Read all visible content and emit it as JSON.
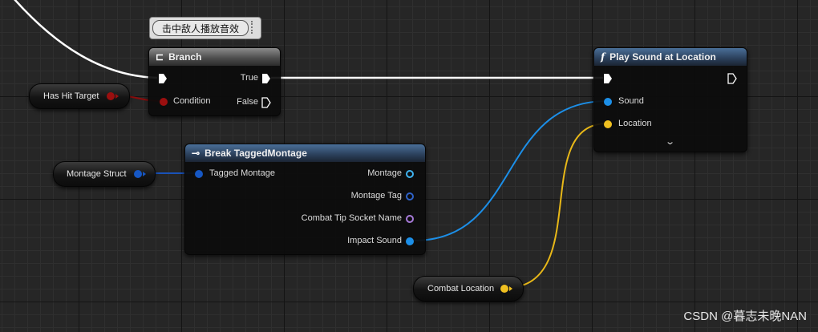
{
  "comment": {
    "text": "击中敌人播放音效"
  },
  "variables": {
    "has_hit_target": "Has Hit Target",
    "montage_struct": "Montage Struct",
    "combat_location": "Combat Location"
  },
  "branch_node": {
    "title": "Branch",
    "condition_label": "Condition",
    "true_label": "True",
    "false_label": "False"
  },
  "break_node": {
    "title": "Break TaggedMontage",
    "input_label": "Tagged Montage",
    "outputs": [
      "Montage",
      "Montage Tag",
      "Combat Tip Socket Name",
      "Impact Sound"
    ]
  },
  "play_sound_node": {
    "title": "Play Sound at Location",
    "sound_label": "Sound",
    "location_label": "Location"
  },
  "watermark": "CSDN @暮志未晚NAN",
  "colors": {
    "exec_wire": "#ffffff",
    "bool_pin": "#9b0f0f",
    "struct_pin": "#1657c4",
    "sound_pin": "#1c8fe8",
    "vector_pin": "#f0c020",
    "name_pin": "#a67ad8"
  },
  "icons": {
    "branch": "branch-icon",
    "break": "break-struct-icon",
    "function": "function-icon",
    "expand": "chevron-down-icon"
  }
}
